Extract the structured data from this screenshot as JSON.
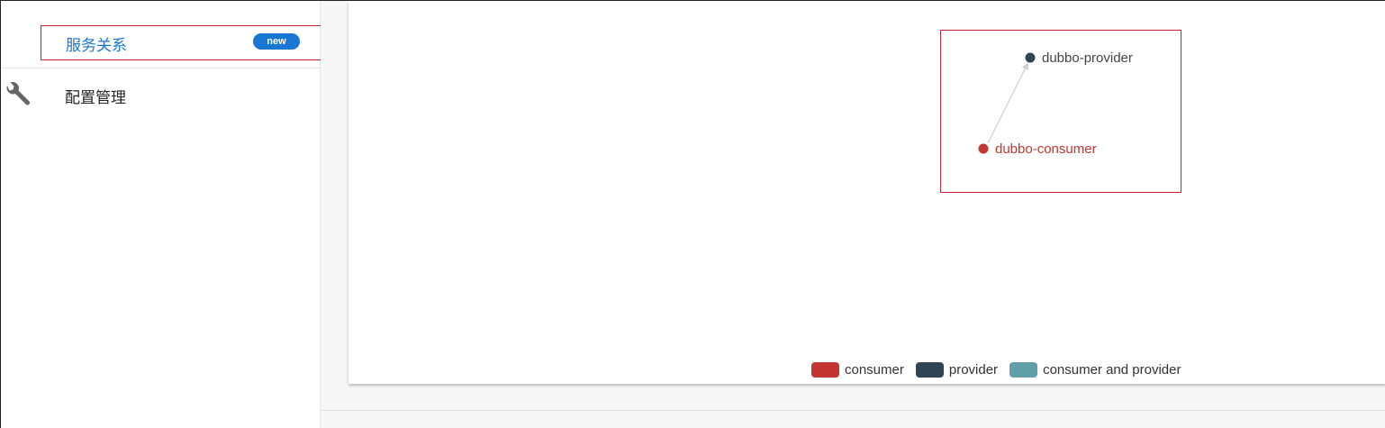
{
  "sidebar": {
    "active_item": {
      "label": "服务关系",
      "badge": "new",
      "color": "#1976d2"
    },
    "items": [
      {
        "label": "配置管理",
        "icon": "wrench-icon"
      }
    ]
  },
  "graph": {
    "nodes": [
      {
        "name": "dubbo-provider",
        "category": "provider",
        "color": "#2f4554"
      },
      {
        "name": "dubbo-consumer",
        "category": "consumer",
        "color": "#c23531"
      }
    ],
    "links": [
      {
        "source": "dubbo-consumer",
        "target": "dubbo-provider"
      }
    ],
    "legend": [
      {
        "label": "consumer",
        "color": "#c23531"
      },
      {
        "label": "provider",
        "color": "#2f4554"
      },
      {
        "label": "consumer and provider",
        "color": "#61a0a8"
      }
    ]
  }
}
